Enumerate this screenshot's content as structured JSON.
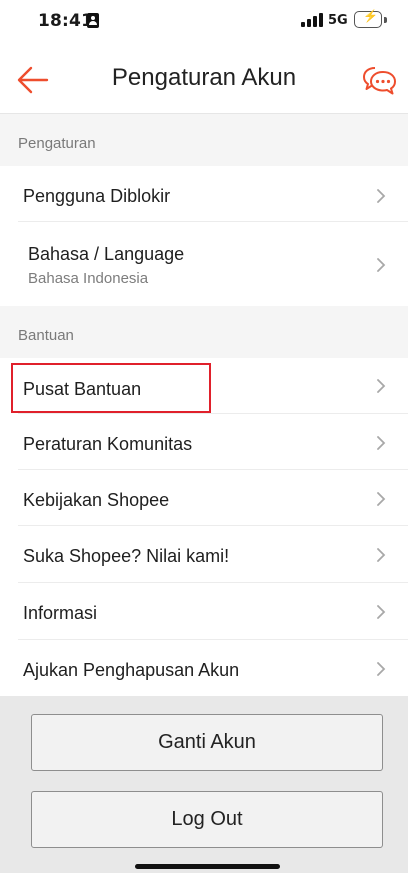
{
  "status_bar": {
    "time": "18:41",
    "network": "5G",
    "battery_charging": true,
    "battery_level": 0.7
  },
  "header": {
    "title": "Pengaturan Akun",
    "accent_color": "#ee4d2d"
  },
  "sections": [
    {
      "title": "Pengaturan",
      "items": [
        {
          "label": "Pengguna Diblokir"
        },
        {
          "label": "Bahasa / Language",
          "sublabel": "Bahasa Indonesia"
        }
      ]
    },
    {
      "title": "Bantuan",
      "items": [
        {
          "label": "Pusat Bantuan"
        },
        {
          "label": "Peraturan Komunitas"
        },
        {
          "label": "Kebijakan Shopee"
        },
        {
          "label": "Suka Shopee? Nilai kami!"
        },
        {
          "label": "Informasi"
        },
        {
          "label": "Ajukan Penghapusan Akun"
        }
      ]
    }
  ],
  "buttons": {
    "switch_account": "Ganti Akun",
    "logout": "Log Out"
  },
  "highlight_color": "#e0202b"
}
